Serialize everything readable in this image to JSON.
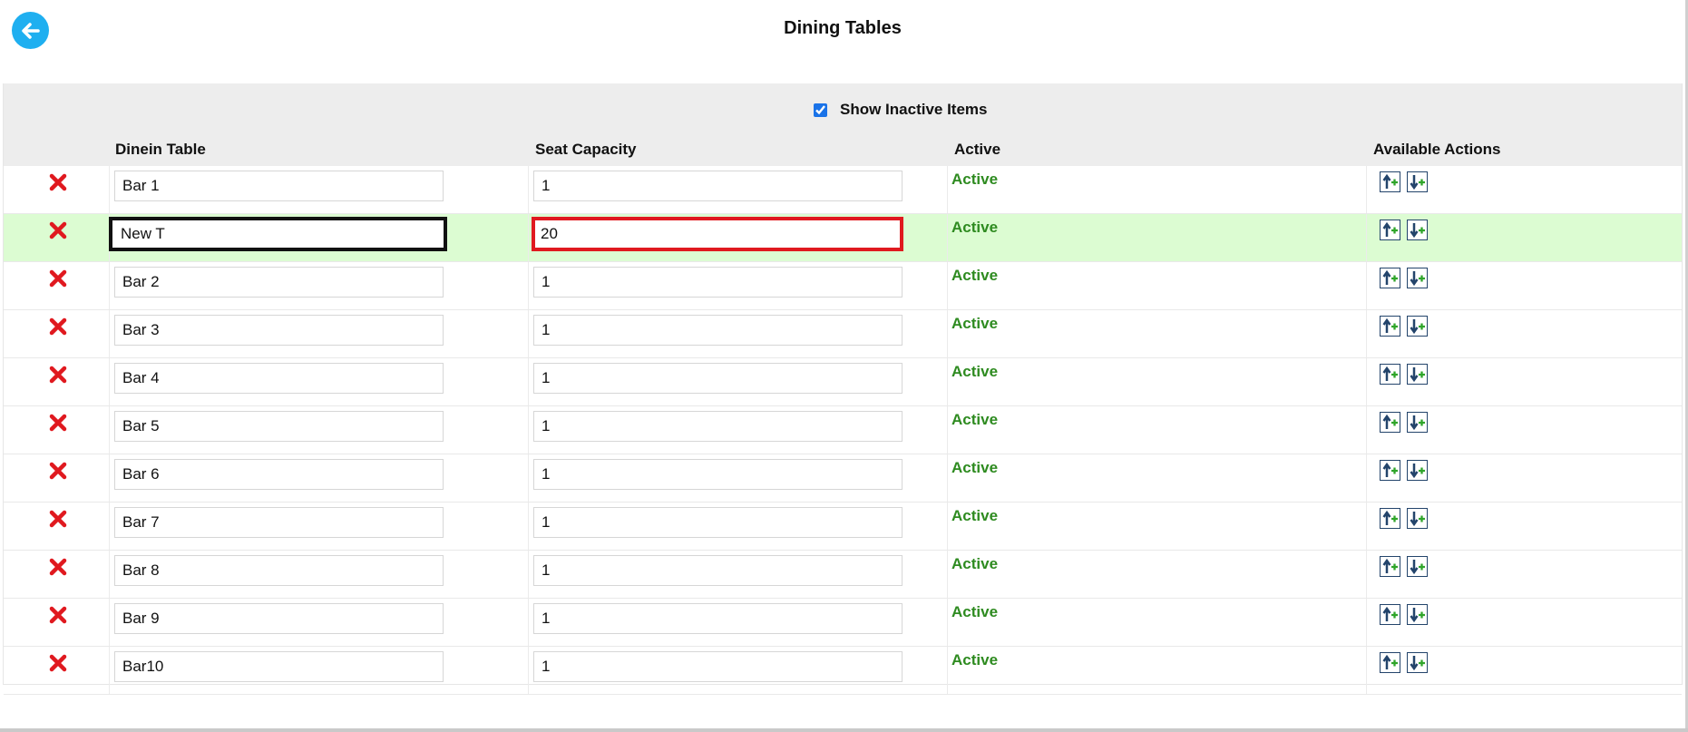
{
  "header": {
    "title": "Dining Tables",
    "back_icon": "arrow-left-icon",
    "back_color": "#1faff0"
  },
  "filter": {
    "show_inactive_label": "Show Inactive Items",
    "show_inactive_checked": true
  },
  "table": {
    "columns": {
      "name": "Dinein Table",
      "seats": "Seat Capacity",
      "active": "Active",
      "actions": "Available Actions"
    },
    "delete_icon": "red-x-icon",
    "move_up_icon": "move-up-add-icon",
    "move_down_icon": "move-down-add-icon",
    "status_color": "#2e8b20",
    "rows": [
      {
        "name": "Bar 1",
        "seats": "1",
        "status": "Active"
      },
      {
        "name": "New T",
        "seats": "20",
        "status": "Active"
      },
      {
        "name": "Bar 2",
        "seats": "1",
        "status": "Active"
      },
      {
        "name": "Bar 3",
        "seats": "1",
        "status": "Active"
      },
      {
        "name": "Bar 4",
        "seats": "1",
        "status": "Active"
      },
      {
        "name": "Bar 5",
        "seats": "1",
        "status": "Active"
      },
      {
        "name": "Bar 6",
        "seats": "1",
        "status": "Active"
      },
      {
        "name": "Bar 7",
        "seats": "1",
        "status": "Active"
      },
      {
        "name": "Bar 8",
        "seats": "1",
        "status": "Active"
      },
      {
        "name": "Bar 9",
        "seats": "1",
        "status": "Active"
      },
      {
        "name": "Bar10",
        "seats": "1",
        "status": "Active"
      }
    ]
  }
}
